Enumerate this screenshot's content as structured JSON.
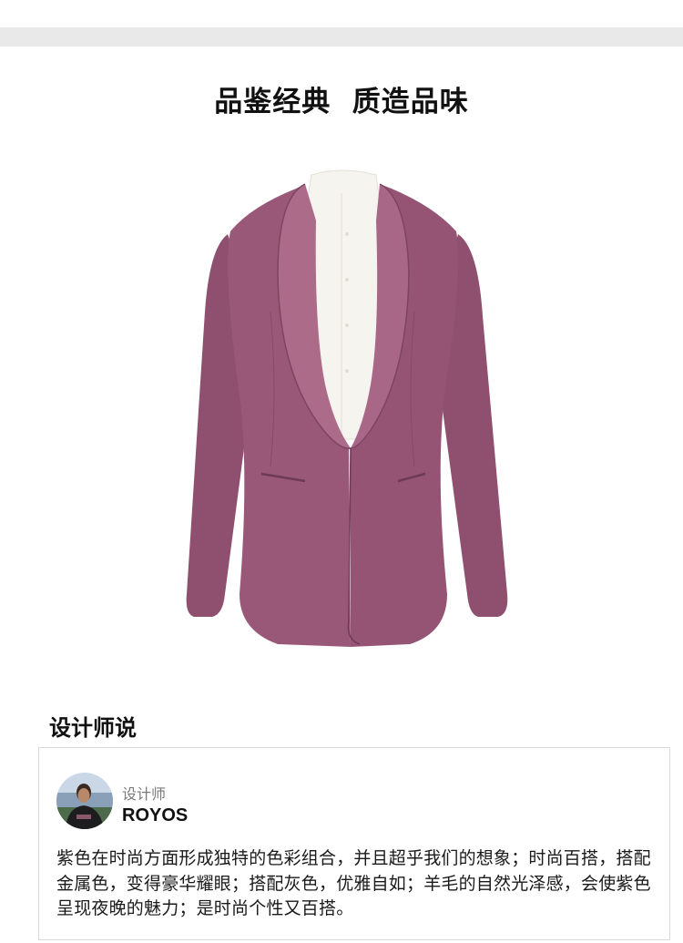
{
  "header": {
    "title": "品鉴经典  质造品味"
  },
  "product": {
    "image_icon": "purple-blazer-image",
    "colors": {
      "jacket": "#9a5878",
      "jacket_shadow": "#7d4462",
      "jacket_light": "#ad6b8a",
      "shirt": "#f6f4ee"
    }
  },
  "designer_section": {
    "title": "设计师说",
    "role": "设计师",
    "name": "ROYOS",
    "avatar_icon": "designer-avatar-icon",
    "quote": "紫色在时尚方面形成独特的色彩组合，并且超乎我们的想象；时尚百搭，搭配金属色，变得豪华耀眼；搭配灰色，优雅自如；羊毛的自然光泽感，会使紫色呈现夜晚的魅力；是时尚个性又百搭。"
  }
}
